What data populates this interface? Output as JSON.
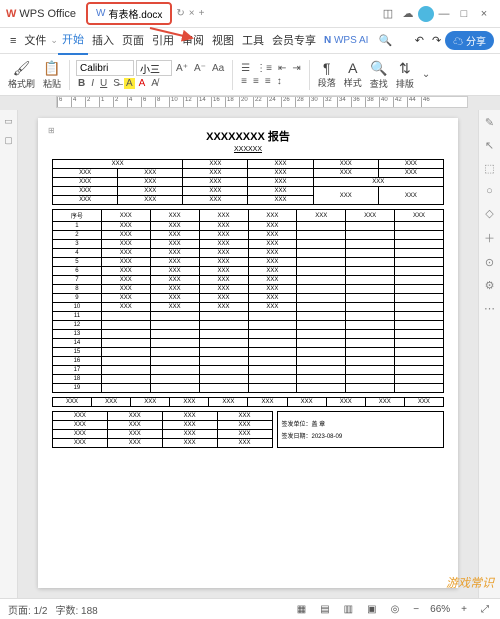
{
  "app": {
    "logo": "W",
    "name": "WPS Office"
  },
  "tab": {
    "filename": "有表格.docx"
  },
  "menu": {
    "hamburger": "≡",
    "file": "文件",
    "items": [
      "开始",
      "插入",
      "页面",
      "引用",
      "审阅",
      "视图",
      "工具",
      "会员专享"
    ],
    "active_index": 0,
    "wpsai": "WPS AI",
    "share": "分享"
  },
  "toolbar": {
    "format_painter": "格式刷",
    "paste": "粘贴",
    "font": "Calibri",
    "size": "小三",
    "para_label": "段落",
    "style_label": "样式",
    "find_label": "查找",
    "layout_label": "排版"
  },
  "ruler": {
    "marks": [
      6,
      4,
      2,
      1,
      2,
      4,
      6,
      8,
      10,
      12,
      14,
      16,
      18,
      20,
      22,
      24,
      26,
      28,
      30,
      32,
      34,
      36,
      38,
      40,
      42,
      44,
      46
    ]
  },
  "doc": {
    "title": "XXXXXXXX 报告",
    "sub": "XXXXXX",
    "xxx": "XXX",
    "seq": "序号",
    "rows": [
      1,
      2,
      3,
      4,
      5,
      6,
      7,
      8,
      9,
      10,
      11,
      12,
      13,
      14,
      15,
      16,
      17,
      18,
      19
    ],
    "sign_unit": "签发单位：盖 章",
    "sign_date": "签发日期：2023-08-09"
  },
  "status": {
    "page": "页面: 1/2",
    "words": "字数: 188",
    "zoom": "66%"
  },
  "watermark": "游戏常识"
}
